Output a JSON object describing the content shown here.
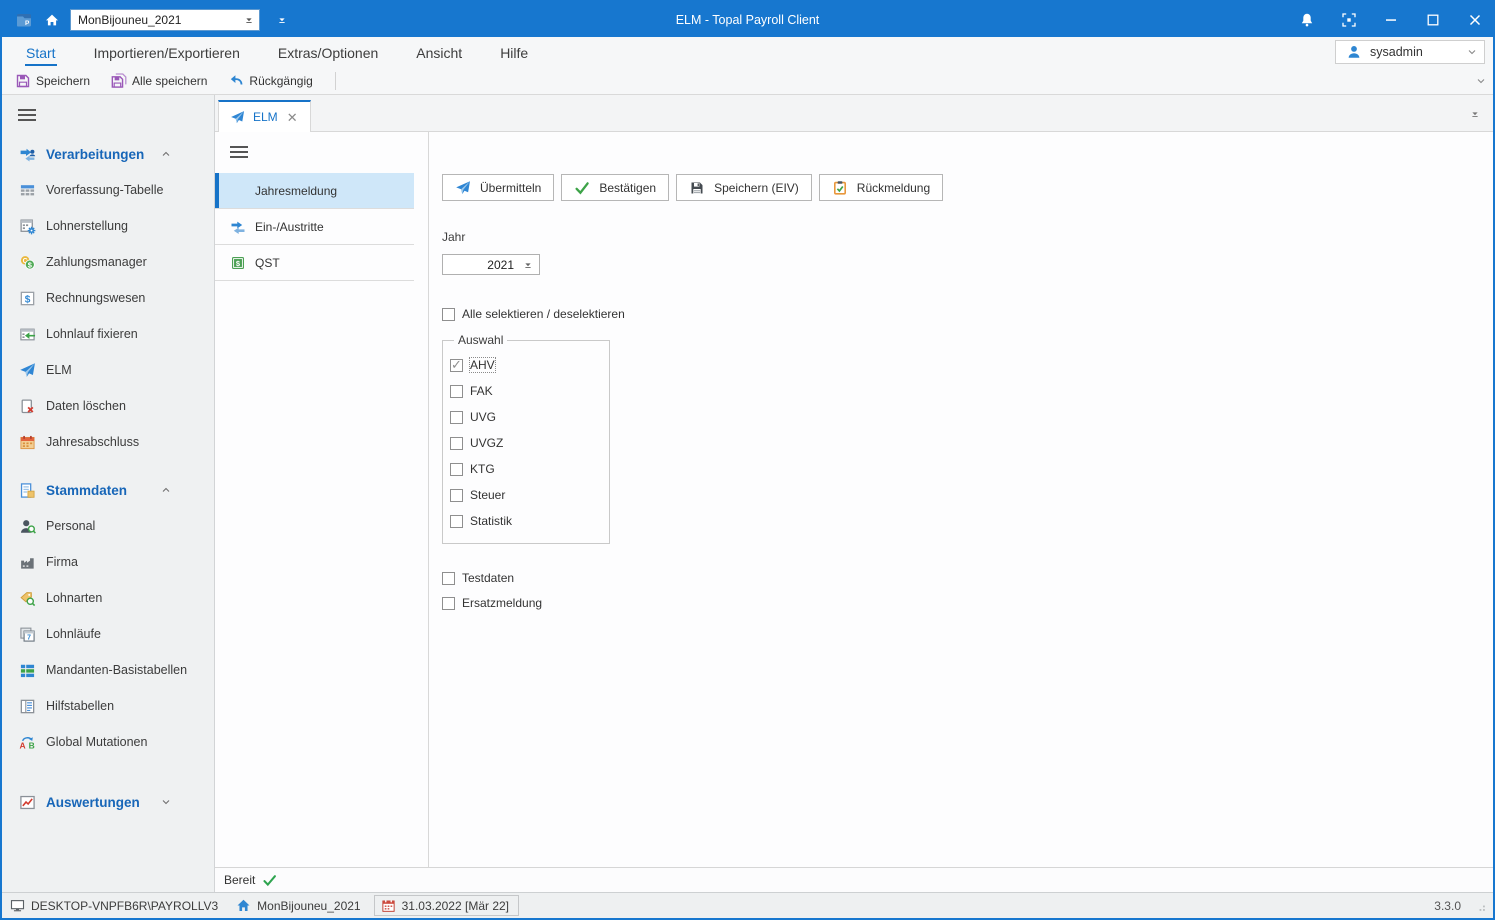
{
  "window": {
    "title": "ELM - Topal Payroll Client"
  },
  "titlebar": {
    "mandant": "MonBijouneu_2021"
  },
  "menubar": {
    "items": [
      "Start",
      "Importieren/Exportieren",
      "Extras/Optionen",
      "Ansicht",
      "Hilfe"
    ],
    "active": "Start",
    "user": "sysadmin"
  },
  "toolbar": {
    "save": "Speichern",
    "save_all": "Alle speichern",
    "undo": "Rückgängig"
  },
  "sidebar": {
    "verarbeitungen": {
      "label": "Verarbeitungen",
      "items": [
        "Vorerfassung-Tabelle",
        "Lohnerstellung",
        "Zahlungsmanager",
        "Rechnungswesen",
        "Lohnlauf fixieren",
        "ELM",
        "Daten löschen",
        "Jahresabschluss"
      ]
    },
    "stammdaten": {
      "label": "Stammdaten",
      "items": [
        "Personal",
        "Firma",
        "Lohnarten",
        "Lohnläufe",
        "Mandanten-Basistabellen",
        "Hilfstabellen",
        "Global Mutationen"
      ]
    },
    "auswertungen": {
      "label": "Auswertungen",
      "collapsed": true
    }
  },
  "tab": {
    "label": "ELM"
  },
  "nav": {
    "items": [
      {
        "label": "Jahresmeldung",
        "selected": true
      },
      {
        "label": "Ein-/Austritte",
        "selected": false
      },
      {
        "label": "QST",
        "selected": false
      }
    ]
  },
  "main": {
    "buttons": [
      {
        "label": "Übermitteln"
      },
      {
        "label": "Bestätigen"
      },
      {
        "label": "Speichern (EIV)"
      },
      {
        "label": "Rückmeldung"
      }
    ],
    "jahr_label": "Jahr",
    "jahr_value": "2021",
    "select_all": "Alle selektieren / deselektieren",
    "select_all_checked": false,
    "group": "Auswahl",
    "options": [
      {
        "label": "AHV",
        "checked": true
      },
      {
        "label": "FAK",
        "checked": false
      },
      {
        "label": "UVG",
        "checked": false
      },
      {
        "label": "UVGZ",
        "checked": false
      },
      {
        "label": "KTG",
        "checked": false
      },
      {
        "label": "Steuer",
        "checked": false
      },
      {
        "label": "Statistik",
        "checked": false
      }
    ],
    "testdaten": {
      "label": "Testdaten",
      "checked": false
    },
    "ersatzmeldung": {
      "label": "Ersatzmeldung",
      "checked": false
    }
  },
  "ready": {
    "label": "Bereit"
  },
  "statusbar": {
    "machine": "DESKTOP-VNPFB6R\\PAYROLLV3",
    "mandant": "MonBijouneu_2021",
    "date": "31.03.2022 [Mär 22]",
    "version": "3.3.0"
  },
  "colors": {
    "titlebar": "#1777cf",
    "accent": "#1673c8",
    "selected_nav_bg": "#cfe7f9",
    "sidebar_bg": "#eff1f2",
    "save_icon_purple": "#9a58b8",
    "success_green": "#3da348",
    "clipboard_orange": "#e8973c",
    "delete_red": "#d23b2f"
  },
  "icons": {
    "app-logo": "blue folder with P",
    "home-icon": "white house",
    "bell-icon": "white bell",
    "expand-icon": "corner brackets",
    "minimize-icon": "–",
    "maximize-icon": "□",
    "close-icon": "✕",
    "user-icon": "blue person",
    "chevron-down-icon": "⌄",
    "combo-caret-icon": "▼",
    "save-icon": "purple floppy",
    "save-all-icon": "double purple floppy",
    "undo-icon": "blue curved arrow",
    "hamburger-icon": "☰",
    "paper-plane-icon": "blue send plane",
    "check-icon": "green ✓",
    "floppy-dark-icon": "dark floppy",
    "clipboard-check-icon": "orange clipboard green check",
    "monitor-icon": "screen",
    "home-blue-icon": "blue house",
    "calendar-icon": "red calendar"
  }
}
